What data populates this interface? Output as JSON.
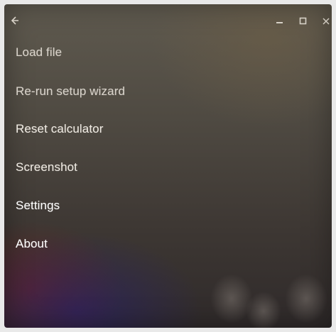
{
  "window": {
    "controls": {
      "back_icon": "back-arrow-icon",
      "minimize_icon": "minimize-icon",
      "maximize_icon": "maximize-icon",
      "close_icon": "close-icon"
    }
  },
  "menu": {
    "items": [
      {
        "label": "Load file"
      },
      {
        "label": "Re-run setup wizard"
      },
      {
        "label": "Reset calculator"
      },
      {
        "label": "Screenshot"
      },
      {
        "label": "Settings"
      },
      {
        "label": "About"
      }
    ]
  }
}
